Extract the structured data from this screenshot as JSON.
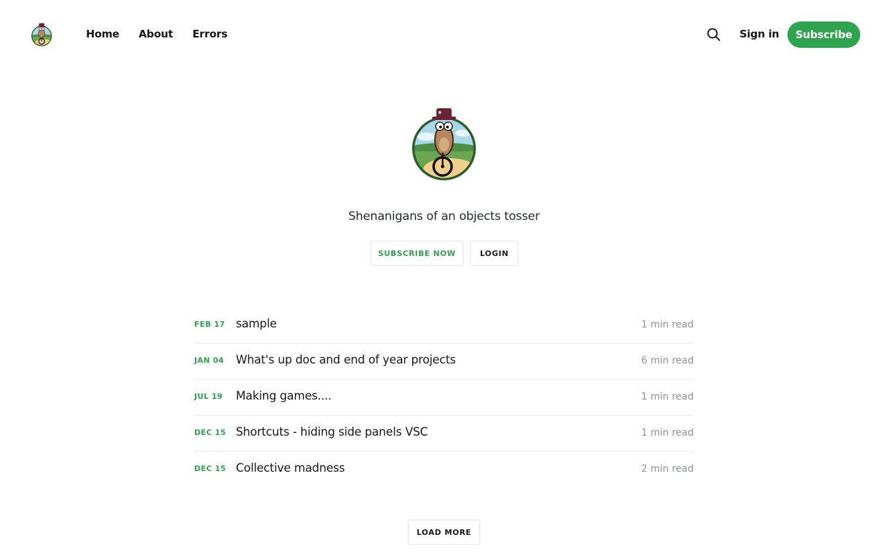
{
  "header": {
    "nav": [
      {
        "label": "Home"
      },
      {
        "label": "About"
      },
      {
        "label": "Errors"
      }
    ],
    "signin_label": "Sign in",
    "subscribe_label": "Subscribe",
    "search_icon": "search-icon",
    "accent_color": "#2ea44f"
  },
  "hero": {
    "tagline": "Shenanigans of an objects tosser",
    "subscribe_now_label": "SUBSCRIBE NOW",
    "login_label": "LOGIN"
  },
  "posts": [
    {
      "date": "FEB 17",
      "title": "sample",
      "read": "1 min read"
    },
    {
      "date": "JAN 04",
      "title": "What's up doc and end of year projects",
      "read": "6 min read"
    },
    {
      "date": "JUL 19",
      "title": "Making games....",
      "read": "1 min read"
    },
    {
      "date": "DEC 15",
      "title": "Shortcuts - hiding side panels VSC",
      "read": "1 min read"
    },
    {
      "date": "DEC 15",
      "title": "Collective madness",
      "read": "2 min read"
    }
  ],
  "load_more_label": "LOAD MORE"
}
